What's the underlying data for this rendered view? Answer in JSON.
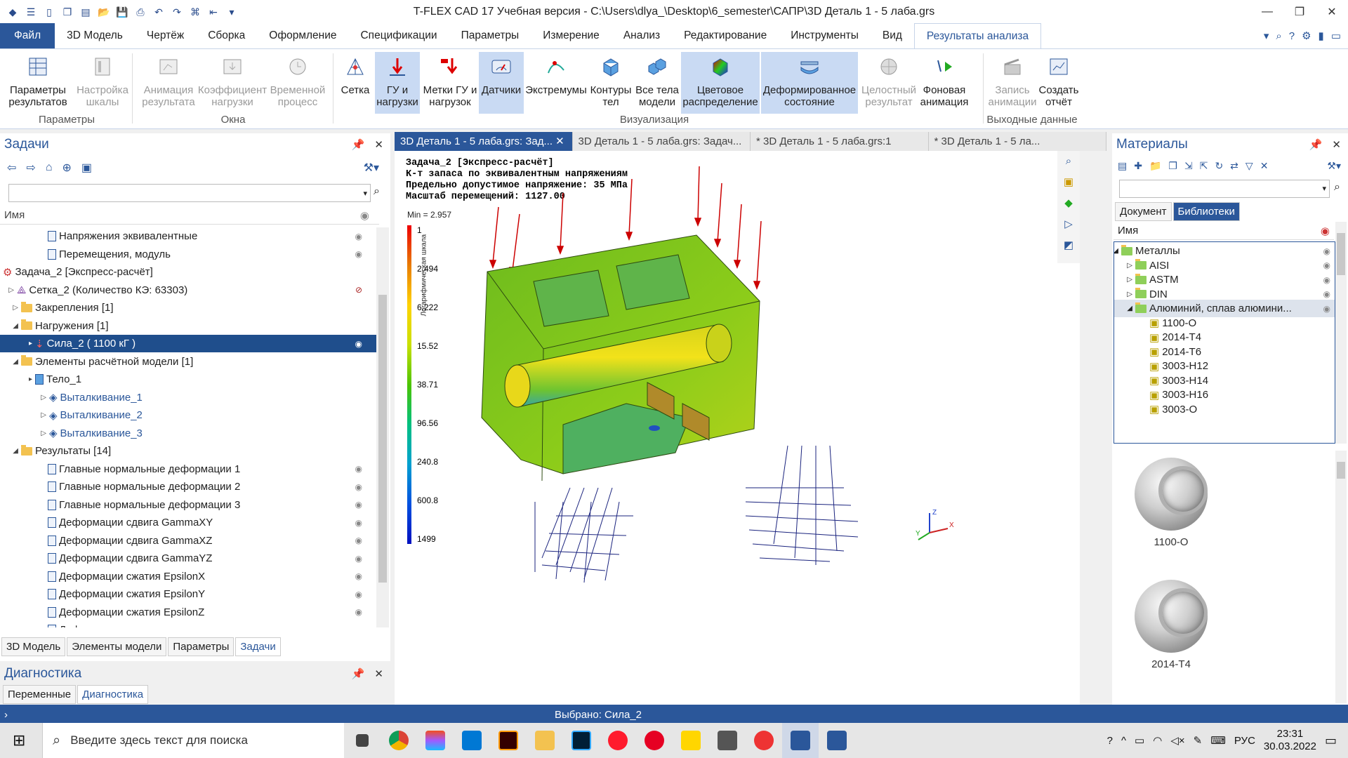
{
  "window": {
    "title": "T-FLEX CAD 17 Учебная версия - C:\\Users\\dlya_\\Desktop\\6_semester\\САПР\\3D Деталь 1 - 5 лаба.grs"
  },
  "menu_tabs": [
    "Файл",
    "3D Модель",
    "Чертёж",
    "Сборка",
    "Оформление",
    "Спецификации",
    "Параметры",
    "Измерение",
    "Анализ",
    "Редактирование",
    "Инструменты",
    "Вид",
    "Результаты анализа"
  ],
  "ribbon": {
    "buttons": [
      {
        "label": "Параметры\nрезультатов",
        "state": "normal"
      },
      {
        "label": "Настройка\nшкалы",
        "state": "disabled"
      },
      {
        "label": "Анимация\nрезультата",
        "state": "disabled"
      },
      {
        "label": "Коэффициент\nнагрузки",
        "state": "disabled"
      },
      {
        "label": "Временной\nпроцесс",
        "state": "disabled"
      },
      {
        "label": "Сетка",
        "state": "normal"
      },
      {
        "label": "ГУ и\nнагрузки",
        "state": "selected"
      },
      {
        "label": "Метки ГУ и\nнагрузок",
        "state": "normal"
      },
      {
        "label": "Датчики",
        "state": "selected"
      },
      {
        "label": "Экстремумы",
        "state": "normal"
      },
      {
        "label": "Контуры\nтел",
        "state": "normal"
      },
      {
        "label": "Все тела\nмодели",
        "state": "normal"
      },
      {
        "label": "Цветовое\nраспределение",
        "state": "selected"
      },
      {
        "label": "Деформированное\nсостояние",
        "state": "selected"
      },
      {
        "label": "Целостный\nрезультат",
        "state": "disabled"
      },
      {
        "label": "Фоновая\nанимация",
        "state": "normal"
      },
      {
        "label": "Запись\nанимации",
        "state": "disabled"
      },
      {
        "label": "Создать\nотчёт",
        "state": "normal"
      }
    ],
    "groups": [
      "Параметры",
      "Окна",
      "Визуализация",
      "Выходные данные"
    ]
  },
  "tasks_panel": {
    "title": "Задачи",
    "search_placeholder": "",
    "column_name": "Имя",
    "rows": [
      {
        "label": "Напряжения эквивалентные",
        "type": "doc"
      },
      {
        "label": "Перемещения, модуль",
        "type": "doc"
      },
      {
        "label": "Задача_2 [Экспресс-расчёт]",
        "type": "task"
      },
      {
        "label": "Сетка_2 (Количество КЭ: 63303)",
        "type": "mesh"
      },
      {
        "label": "Закрепления [1]",
        "type": "folder"
      },
      {
        "label": "Нагружения [1]",
        "type": "folder"
      },
      {
        "label": "Сила_2 ( 1100 кГ )",
        "type": "force"
      },
      {
        "label": "Элементы расчётной модели [1]",
        "type": "folder"
      },
      {
        "label": "Тело_1",
        "type": "body"
      },
      {
        "label": "Выталкивание_1",
        "type": "op"
      },
      {
        "label": "Выталкивание_2",
        "type": "op"
      },
      {
        "label": "Выталкивание_3",
        "type": "op"
      },
      {
        "label": "Результаты [14]",
        "type": "folder"
      },
      {
        "label": "Главные нормальные деформации 1",
        "type": "doc"
      },
      {
        "label": "Главные нормальные деформации 2",
        "type": "doc"
      },
      {
        "label": "Главные нормальные деформации 3",
        "type": "doc"
      },
      {
        "label": "Деформации сдвига GammaXY",
        "type": "doc"
      },
      {
        "label": "Деформации сдвига GammaXZ",
        "type": "doc"
      },
      {
        "label": "Деформации сдвига GammaYZ",
        "type": "doc"
      },
      {
        "label": "Деформации сжатия EpsilonX",
        "type": "doc"
      },
      {
        "label": "Деформации сжатия EpsilonY",
        "type": "doc"
      },
      {
        "label": "Деформации сжатия EpsilonZ",
        "type": "doc"
      },
      {
        "label": "Деформации эквивалентные",
        "type": "doc"
      }
    ],
    "bottom_tabs": [
      "3D Модель",
      "Элементы модели",
      "Параметры",
      "Задачи"
    ]
  },
  "diagnostics_panel": {
    "title": "Диагностика",
    "tabs": [
      "Переменные",
      "Диагностика"
    ]
  },
  "doc_tabs": [
    "3D Деталь 1 - 5 лаба.grs: Зад...",
    "3D Деталь 1 - 5 лаба.grs: Задач...",
    "* 3D Деталь 1 - 5 лаба.grs:1",
    "* 3D Деталь 1 - 5 ла..."
  ],
  "viewport": {
    "info_lines": [
      "Задача_2 [Экспресс-расчёт]",
      "К-т запаса по эквивалентным напряжениям",
      "Предельно допустимое напряжение: 35 МПа",
      "Масштаб перемещений: 1127.00"
    ],
    "min_label": "Min = 2.957",
    "scale_title": "Логарифмическая шкала",
    "scale_values": [
      "1",
      "2.494",
      "6.222",
      "15.52",
      "38.71",
      "96.56",
      "240.8",
      "600.8",
      "1499"
    ]
  },
  "materials_panel": {
    "title": "Материалы",
    "search_placeholder": "",
    "tabs": [
      "Документ",
      "Библиотеки"
    ],
    "column_name": "Имя",
    "tree": [
      {
        "label": "Металлы",
        "level": 0
      },
      {
        "label": "AISI",
        "level": 1
      },
      {
        "label": "ASTM",
        "level": 1
      },
      {
        "label": "DIN",
        "level": 1
      },
      {
        "label": "Алюминий, сплав алюмини...",
        "level": 1
      },
      {
        "label": "1100-O",
        "level": 2
      },
      {
        "label": "2014-T4",
        "level": 2
      },
      {
        "label": "2014-T6",
        "level": 2
      },
      {
        "label": "3003-H12",
        "level": 2
      },
      {
        "label": "3003-H14",
        "level": 2
      },
      {
        "label": "3003-H16",
        "level": 2
      },
      {
        "label": "3003-O",
        "level": 2
      }
    ],
    "tiles": [
      "1100-O",
      "2014-T4"
    ]
  },
  "status": {
    "selected": "Выбрано: Сила_2"
  },
  "taskbar": {
    "search_placeholder": "Введите здесь текст для поиска",
    "lang": "РУС",
    "time": "23:31",
    "date": "30.03.2022"
  },
  "colors": {
    "accent": "#2b579a",
    "selected": "#1f4e8c"
  }
}
